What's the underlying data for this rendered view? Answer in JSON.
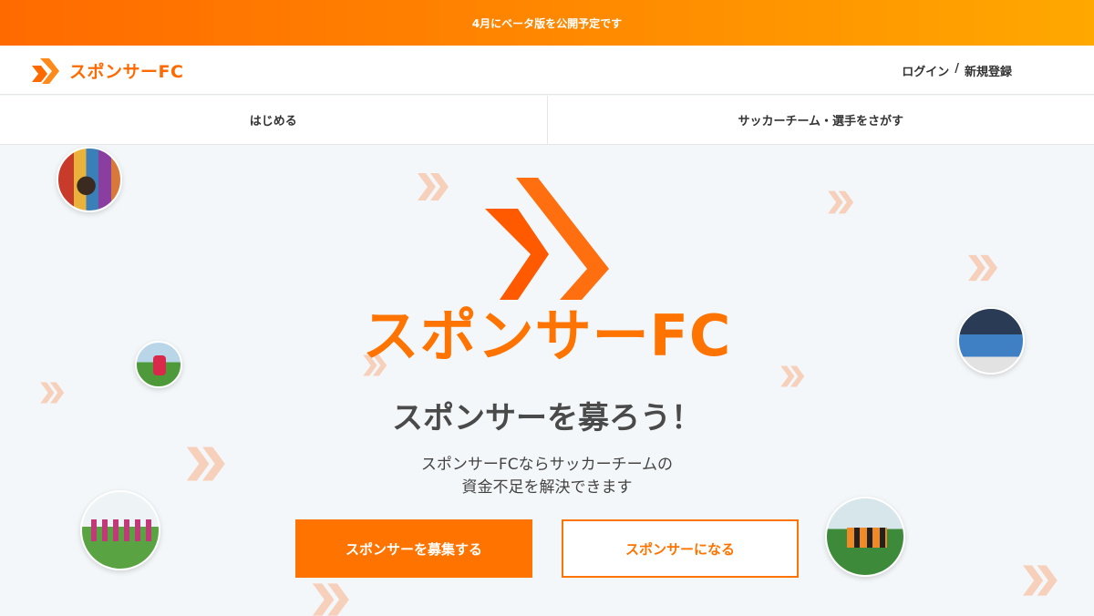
{
  "announcement": {
    "text": "4月にベータ版を公開予定です"
  },
  "header": {
    "brand": "スポンサーFC",
    "login": "ログイン",
    "separator": "/",
    "signup": "新規登録"
  },
  "nav": {
    "items": [
      {
        "label": "はじめる"
      },
      {
        "label": "サッカーチーム・選手をさがす"
      }
    ]
  },
  "hero": {
    "brand": "スポンサーFC",
    "catchphrase": "スポンサーを募ろう！",
    "description_line1": "スポンサーFCならサッカーチームの",
    "description_line2": "資金不足を解決できます",
    "primary_button": "スポンサーを募集する",
    "secondary_button": "スポンサーになる"
  },
  "colors": {
    "brand_orange": "#ff7300",
    "announcement_gradient_start": "#ff6a00",
    "announcement_gradient_end": "#ffa800"
  },
  "icons": [
    "chevrons-logo-icon",
    "chevron-decoration-icon"
  ]
}
